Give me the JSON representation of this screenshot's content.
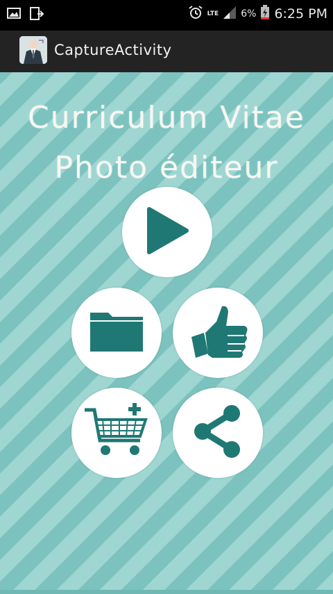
{
  "status_bar": {
    "network_type": "LTE",
    "battery_percent": "6%",
    "time": "6:25 PM"
  },
  "action_bar": {
    "title": "CaptureActivity",
    "icon": "app-icon"
  },
  "main": {
    "title_line1": "Curriculum Vitae",
    "title_line2": "Photo éditeur",
    "buttons": [
      {
        "name": "play",
        "icon": "play-icon"
      },
      {
        "name": "gallery",
        "icon": "folder-icon"
      },
      {
        "name": "like",
        "icon": "thumbs-up-icon"
      },
      {
        "name": "shop",
        "icon": "cart-plus-icon"
      },
      {
        "name": "share",
        "icon": "share-icon"
      }
    ]
  },
  "colors": {
    "accent": "#1f7874",
    "stripe_light": "#9fd6d2",
    "stripe_dark": "#7cc3bf",
    "action_bar": "#232323"
  }
}
